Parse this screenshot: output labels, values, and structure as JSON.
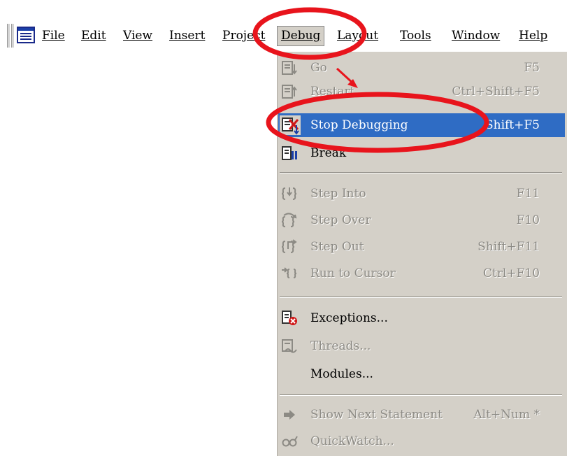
{
  "menubar": {
    "items": [
      {
        "label": "File",
        "mnemonic_index": 0
      },
      {
        "label": "Edit",
        "mnemonic_index": 0
      },
      {
        "label": "View",
        "mnemonic_index": 0
      },
      {
        "label": "Insert",
        "mnemonic_index": 0
      },
      {
        "label": "Project",
        "mnemonic_index": 0
      },
      {
        "label": "Debug",
        "mnemonic_index": 0
      },
      {
        "label": "Layout",
        "mnemonic_index": 0
      },
      {
        "label": "Tools",
        "mnemonic_index": 0
      },
      {
        "label": "Window",
        "mnemonic_index": 0
      },
      {
        "label": "Help",
        "mnemonic_index": 0
      }
    ],
    "open_menu": "Debug"
  },
  "debug_menu": {
    "items": [
      {
        "label": "Go",
        "shortcut": "F5",
        "enabled": false,
        "icon": "go-icon"
      },
      {
        "label": "Restart",
        "shortcut": "Ctrl+Shift+F5",
        "enabled": false,
        "icon": "restart-icon"
      },
      {
        "label": "Stop Debugging",
        "shortcut": "Shift+F5",
        "enabled": true,
        "selected": true,
        "icon": "stop-debugging-icon"
      },
      {
        "label": "Break",
        "shortcut": "",
        "enabled": true,
        "icon": "break-icon"
      },
      {
        "label": "Step Into",
        "shortcut": "F11",
        "enabled": false,
        "icon": "step-into-icon"
      },
      {
        "label": "Step Over",
        "shortcut": "F10",
        "enabled": false,
        "icon": "step-over-icon"
      },
      {
        "label": "Step Out",
        "shortcut": "Shift+F11",
        "enabled": false,
        "icon": "step-out-icon"
      },
      {
        "label": "Run to Cursor",
        "shortcut": "Ctrl+F10",
        "enabled": false,
        "icon": "run-to-cursor-icon"
      },
      {
        "label": "Exceptions...",
        "shortcut": "",
        "enabled": true,
        "icon": "exceptions-icon"
      },
      {
        "label": "Threads...",
        "shortcut": "",
        "enabled": false,
        "icon": "threads-icon"
      },
      {
        "label": "Modules...",
        "shortcut": "",
        "enabled": true,
        "icon": ""
      },
      {
        "label": "Show Next Statement",
        "shortcut": "Alt+Num *",
        "enabled": false,
        "icon": "show-next-statement-icon"
      },
      {
        "label": "QuickWatch...",
        "shortcut": "",
        "enabled": false,
        "icon": "quickwatch-icon"
      }
    ]
  },
  "annotations": {
    "color": "#e8141c"
  },
  "colors": {
    "menu_bg": "#d4d0c8",
    "highlight": "#2f6cc4",
    "disabled_text": "#8c8a84"
  }
}
